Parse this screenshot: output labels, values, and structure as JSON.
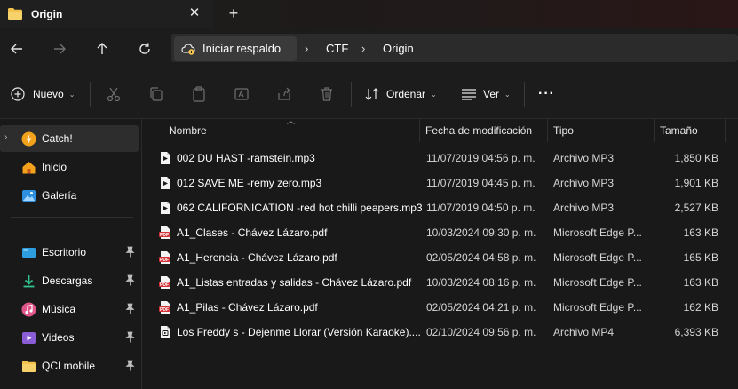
{
  "window": {
    "tab_title": "Origin",
    "tab_close_glyph": "✕",
    "new_tab_glyph": "+"
  },
  "nav": {
    "back_icon": "arrow-left-icon",
    "forward_icon": "arrow-right-icon",
    "up_icon": "arrow-up-icon",
    "refresh_icon": "refresh-icon"
  },
  "address": {
    "backup_label": "Iniciar respaldo",
    "separator": "›",
    "crumbs": [
      "CTF",
      "Origin"
    ]
  },
  "toolbar": {
    "new_label": "Nuevo",
    "sort_label": "Ordenar",
    "view_label": "Ver",
    "more_glyph": "···",
    "caret": "⌄"
  },
  "sidebar": {
    "items": [
      {
        "label": "Catch!",
        "icon": "bolt-icon"
      },
      {
        "label": "Inicio",
        "icon": "home-icon"
      },
      {
        "label": "Galería",
        "icon": "gallery-icon"
      },
      {
        "label": "Escritorio",
        "icon": "desktop-icon"
      },
      {
        "label": "Descargas",
        "icon": "download-icon"
      },
      {
        "label": "Música",
        "icon": "music-icon"
      },
      {
        "label": "Videos",
        "icon": "video-icon"
      },
      {
        "label": "QCI mobile",
        "icon": "folder-icon"
      }
    ]
  },
  "columns": {
    "name": "Nombre",
    "date": "Fecha de modificación",
    "type": "Tipo",
    "size": "Tamaño"
  },
  "files": [
    {
      "name": "002 DU HAST -ramstein.mp3",
      "date": "11/07/2019 04:56 p. m.",
      "type": "Archivo MP3",
      "size": "1,850 KB",
      "icon": "audio-file-icon"
    },
    {
      "name": "012 SAVE ME -remy zero.mp3",
      "date": "11/07/2019 04:45 p. m.",
      "type": "Archivo MP3",
      "size": "1,901 KB",
      "icon": "audio-file-icon"
    },
    {
      "name": "062 CALIFORNICATION -red hot chilli peapers.mp3",
      "date": "11/07/2019 04:50 p. m.",
      "type": "Archivo MP3",
      "size": "2,527 KB",
      "icon": "audio-file-icon"
    },
    {
      "name": "A1_Clases - Chávez Lázaro.pdf",
      "date": "10/03/2024 09:30 p. m.",
      "type": "Microsoft Edge P...",
      "size": "163 KB",
      "icon": "pdf-file-icon"
    },
    {
      "name": "A1_Herencia - Chávez Lázaro.pdf",
      "date": "02/05/2024 04:58 p. m.",
      "type": "Microsoft Edge P...",
      "size": "165 KB",
      "icon": "pdf-file-icon"
    },
    {
      "name": "A1_Listas entradas y salidas - Chávez Lázaro.pdf",
      "date": "10/03/2024 08:16 p. m.",
      "type": "Microsoft Edge P...",
      "size": "163 KB",
      "icon": "pdf-file-icon"
    },
    {
      "name": "A1_Pilas - Chávez Lázaro.pdf",
      "date": "02/05/2024 04:21 p. m.",
      "type": "Microsoft Edge P...",
      "size": "162 KB",
      "icon": "pdf-file-icon"
    },
    {
      "name": "Los Freddy s - Dejenme Llorar (Versión Karaoke)....",
      "date": "02/10/2024 09:56 p. m.",
      "type": "Archivo MP4",
      "size": "6,393 KB",
      "icon": "video-file-icon"
    }
  ],
  "colors": {
    "background": "#191919",
    "accent_blue": "#4ea1e8",
    "folder_yellow": "#f2c14e",
    "pdf_red": "#d13438"
  }
}
